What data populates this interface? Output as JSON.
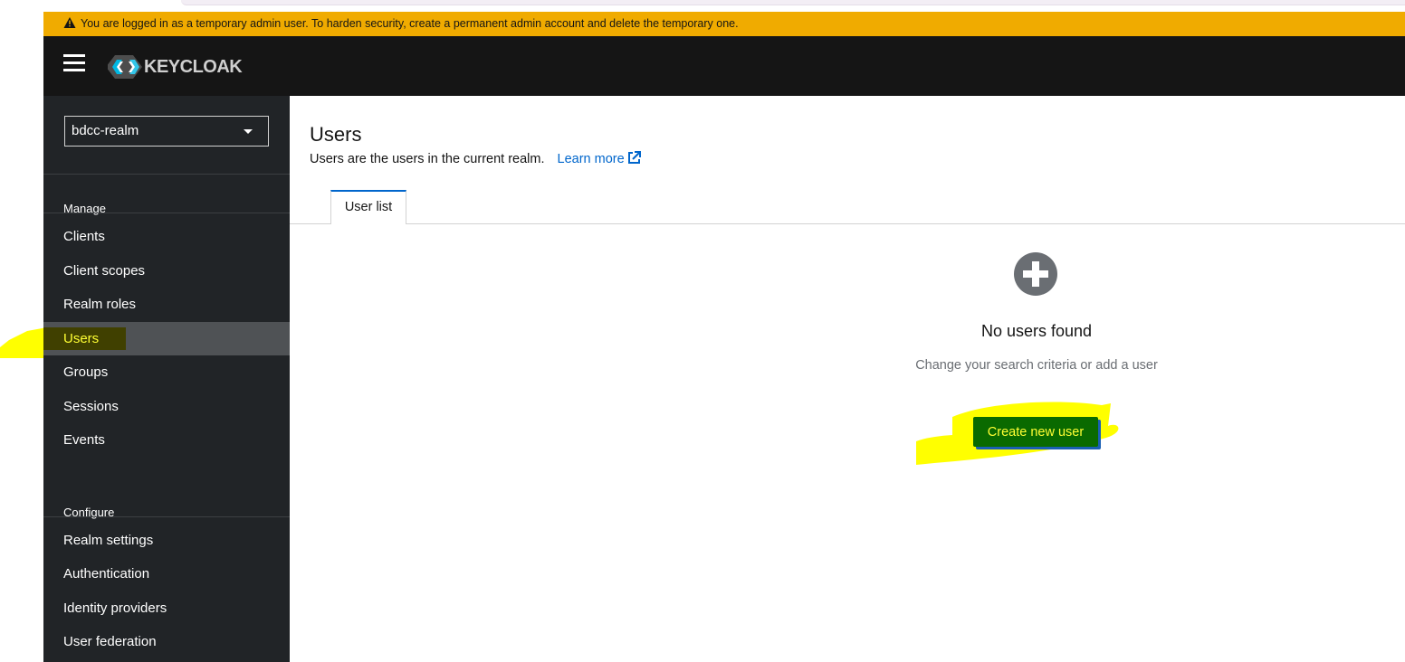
{
  "banner": {
    "icon": "warning-icon",
    "text": "You are logged in as a temporary admin user. To harden security, create a permanent admin account and delete the temporary one."
  },
  "masthead": {
    "menu_icon": "hamburger-icon",
    "logo_text": "KEYCLOAK"
  },
  "sidebar": {
    "realm": "bdcc-realm",
    "sections": [
      {
        "title": "Manage",
        "items": [
          "Clients",
          "Client scopes",
          "Realm roles",
          "Users",
          "Groups",
          "Sessions",
          "Events"
        ]
      },
      {
        "title": "Configure",
        "items": [
          "Realm settings",
          "Authentication",
          "Identity providers",
          "User federation"
        ]
      }
    ],
    "active_item": "Users"
  },
  "main": {
    "title": "Users",
    "description": "Users are the users in the current realm.",
    "learn_more": "Learn more",
    "tabs": [
      {
        "label": "User list",
        "active": true
      }
    ],
    "empty_state": {
      "icon": "plus-circle-icon",
      "title": "No users found",
      "body": "Change your search criteria or add a user",
      "button": "Create new user"
    }
  },
  "colors": {
    "banner": "#f0ab00",
    "masthead": "#151515",
    "sidebar": "#212427",
    "link": "#0066cc",
    "highlight": "#ffff00"
  }
}
